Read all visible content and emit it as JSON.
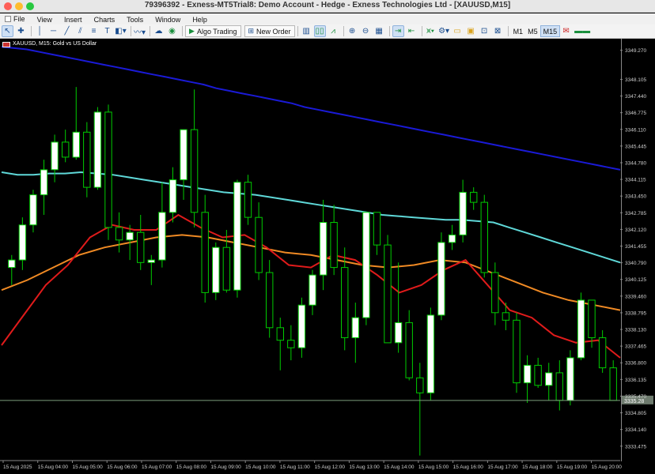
{
  "window": {
    "title": "79396392 - Exness-MT5Trial8: Demo Account - Hedge - Exness Technologies Ltd - [XAUUSD,M15]"
  },
  "menu": {
    "items": [
      "File",
      "View",
      "Insert",
      "Charts",
      "Tools",
      "Window",
      "Help"
    ]
  },
  "toolbar": {
    "algo_trading": "Algo Trading",
    "new_order": "New Order",
    "timeframes": [
      "M1",
      "M5",
      "M15"
    ],
    "active_timeframe": "M15",
    "icons": [
      "cursor-icon",
      "crosshair-icon",
      "vertical-line-icon",
      "horizontal-line-icon",
      "trendline-icon",
      "channel-icon",
      "fibonacci-icon",
      "text-icon",
      "shapes-icon",
      "indicator-icon",
      "cloud-icon",
      "signals-icon",
      "play-icon",
      "new-order-icon",
      "depth-icon",
      "bar-chart-icon",
      "candles-icon",
      "line-chart-icon",
      "zoom-in-icon",
      "zoom-out-icon",
      "grid-icon",
      "autoscroll-icon",
      "chart-shift-icon",
      "period-sep-icon",
      "templates-icon",
      "folder-icon",
      "save-icon",
      "alerts-icon",
      "history-icon"
    ]
  },
  "chart": {
    "symbol": "XAUUSD, M15:  Gold vs US Dollar",
    "current_price": "3335.28",
    "y_ticks": [
      "3349.270",
      "3348.105",
      "3347.440",
      "3346.775",
      "3346.110",
      "3345.445",
      "3344.780",
      "3344.115",
      "3343.450",
      "3342.785",
      "3342.120",
      "3341.455",
      "3340.790",
      "3340.125",
      "3339.460",
      "3338.795",
      "3338.130",
      "3337.465",
      "3336.800",
      "3336.135",
      "3335.470",
      "3334.805",
      "3334.140",
      "3333.475"
    ],
    "x_ticks": [
      "15 Aug 2025",
      "15 Aug 04:00",
      "15 Aug 05:00",
      "15 Aug 06:00",
      "15 Aug 07:00",
      "15 Aug 08:00",
      "15 Aug 09:00",
      "15 Aug 10:00",
      "15 Aug 11:00",
      "15 Aug 12:00",
      "15 Aug 13:00",
      "15 Aug 14:00",
      "15 Aug 15:00",
      "15 Aug 16:00",
      "15 Aug 17:00",
      "15 Aug 18:00",
      "15 Aug 19:00",
      "15 Aug 20:00"
    ],
    "colors": {
      "bull": "#ffffff",
      "bull_border": "#00cc00",
      "bear": "#000000",
      "wick": "#00cc00",
      "ma_blue": "#1a1ad6",
      "ma_cyan": "#5fd8d8",
      "ma_red": "#e01b1b",
      "ma_orange": "#f08a24",
      "price_line": "#7d9e7d"
    }
  },
  "chart_data": {
    "type": "candlestick",
    "ylim": [
      3332.9,
      3349.6
    ],
    "candles": [
      [
        3340.6,
        3341.1,
        3339.9,
        3340.9
      ],
      [
        3340.9,
        3342.6,
        3340.5,
        3342.3
      ],
      [
        3342.3,
        3343.7,
        3342.0,
        3343.5
      ],
      [
        3343.5,
        3344.9,
        3342.7,
        3344.5
      ],
      [
        3344.5,
        3345.9,
        3344.0,
        3345.6
      ],
      [
        3345.6,
        3346.1,
        3344.8,
        3345.0
      ],
      [
        3345.0,
        3347.8,
        3344.9,
        3346.0
      ],
      [
        3346.0,
        3346.4,
        3343.4,
        3343.8
      ],
      [
        3343.8,
        3347.0,
        3343.7,
        3346.8
      ],
      [
        3346.8,
        3347.1,
        3341.7,
        3342.2
      ],
      [
        3342.2,
        3342.8,
        3341.2,
        3341.7
      ],
      [
        3341.7,
        3342.3,
        3340.9,
        3342.0
      ],
      [
        3342.0,
        3342.7,
        3340.5,
        3340.8
      ],
      [
        3340.8,
        3341.1,
        3339.9,
        3340.9
      ],
      [
        3340.9,
        3344.0,
        3340.6,
        3342.8
      ],
      [
        3342.8,
        3344.6,
        3342.4,
        3344.1
      ],
      [
        3344.1,
        3346.1,
        3343.3,
        3346.1
      ],
      [
        3346.1,
        3347.7,
        3342.2,
        3342.8
      ],
      [
        3342.8,
        3343.5,
        3339.2,
        3339.6
      ],
      [
        3339.6,
        3341.6,
        3339.3,
        3341.4
      ],
      [
        3341.4,
        3342.1,
        3339.6,
        3339.7
      ],
      [
        3339.7,
        3344.1,
        3339.4,
        3344.0
      ],
      [
        3344.0,
        3344.3,
        3342.3,
        3342.6
      ],
      [
        3342.6,
        3343.2,
        3340.1,
        3340.4
      ],
      [
        3340.4,
        3340.9,
        3337.8,
        3338.2
      ],
      [
        3338.2,
        3338.6,
        3336.5,
        3337.7
      ],
      [
        3337.7,
        3338.3,
        3336.9,
        3337.4
      ],
      [
        3337.4,
        3339.4,
        3337.0,
        3339.1
      ],
      [
        3339.1,
        3340.5,
        3338.7,
        3340.3
      ],
      [
        3340.3,
        3343.3,
        3339.7,
        3342.4
      ],
      [
        3342.4,
        3343.1,
        3340.3,
        3340.6
      ],
      [
        3340.6,
        3341.4,
        3337.3,
        3337.8
      ],
      [
        3337.8,
        3339.2,
        3336.8,
        3338.6
      ],
      [
        3338.6,
        3342.1,
        3338.3,
        3342.8
      ],
      [
        3342.8,
        3342.6,
        3341.1,
        3341.5
      ],
      [
        3341.5,
        3341.9,
        3337.6,
        3337.6
      ],
      [
        3337.6,
        3340.8,
        3337.2,
        3338.4
      ],
      [
        3338.4,
        3338.9,
        3336.1,
        3336.2
      ],
      [
        3336.2,
        3336.8,
        3333.1,
        3335.6
      ],
      [
        3335.6,
        3339.0,
        3335.3,
        3338.7
      ],
      [
        3338.7,
        3342.0,
        3338.5,
        3341.6
      ],
      [
        3341.6,
        3342.3,
        3341.3,
        3341.9
      ],
      [
        3341.9,
        3344.1,
        3341.6,
        3343.6
      ],
      [
        3343.6,
        3343.8,
        3342.9,
        3343.2
      ],
      [
        3343.2,
        3343.5,
        3340.2,
        3340.4
      ],
      [
        3340.4,
        3340.8,
        3338.3,
        3338.8
      ],
      [
        3338.8,
        3339.2,
        3338.1,
        3338.5
      ],
      [
        3338.5,
        3338.8,
        3335.6,
        3336.0
      ],
      [
        3336.0,
        3337.1,
        3335.2,
        3336.7
      ],
      [
        3336.7,
        3337.0,
        3335.8,
        3335.9
      ],
      [
        3335.9,
        3336.8,
        3335.3,
        3336.4
      ],
      [
        3336.4,
        3336.9,
        3334.9,
        3335.3
      ],
      [
        3335.3,
        3337.3,
        3335.1,
        3337.0
      ],
      [
        3337.0,
        3339.6,
        3336.9,
        3339.3
      ],
      [
        3339.3,
        3339.3,
        3337.4,
        3337.8
      ],
      [
        3337.8,
        3338.1,
        3336.4,
        3336.6
      ],
      [
        3336.6,
        3336.9,
        3335.3,
        3335.3
      ]
    ],
    "ma_blue": [
      3349.4,
      3349.35,
      3349.3,
      3349.2,
      3349.1,
      3349.0,
      3348.9,
      3348.8,
      3348.7,
      3348.6,
      3348.5,
      3348.4,
      3348.3,
      3348.2,
      3348.1,
      3348.0,
      3347.9,
      3347.75,
      3347.65,
      3347.55,
      3347.45,
      3347.35,
      3347.25,
      3347.15,
      3347.0,
      3346.9,
      3346.8,
      3346.7,
      3346.6,
      3346.5,
      3346.4,
      3346.3,
      3346.2,
      3346.1,
      3346.0,
      3345.9,
      3345.8,
      3345.7,
      3345.6,
      3345.5,
      3345.4,
      3345.3,
      3345.2,
      3345.1,
      3345.0,
      3344.9,
      3344.8,
      3344.7,
      3344.6,
      3344.5
    ],
    "ma_cyan": [
      3344.4,
      3344.3,
      3344.3,
      3344.35,
      3344.35,
      3344.4,
      3344.35,
      3344.3,
      3344.2,
      3344.1,
      3344.0,
      3343.9,
      3343.8,
      3343.7,
      3343.6,
      3343.55,
      3343.5,
      3343.4,
      3343.3,
      3343.2,
      3343.1,
      3343.0,
      3342.9,
      3342.8,
      3342.7,
      3342.65,
      3342.6,
      3342.55,
      3342.5,
      3342.5,
      3342.45,
      3342.4,
      3342.2,
      3342.0,
      3341.8,
      3341.6,
      3341.4,
      3341.2,
      3341.0,
      3340.8
    ],
    "ma_red": [
      3337.5,
      3338.7,
      3339.9,
      3340.7,
      3341.8,
      3342.3,
      3342.1,
      3342.1,
      3342.7,
      3342.2,
      3341.8,
      3341.9,
      3341.4,
      3340.7,
      3340.6,
      3341.1,
      3340.9,
      3340.3,
      3339.6,
      3339.9,
      3340.5,
      3340.9,
      3339.9,
      3338.9,
      3338.6,
      3337.9,
      3337.6,
      3337.7,
      3337.0
    ],
    "ma_orange": [
      3339.7,
      3340.1,
      3340.6,
      3341.1,
      3341.4,
      3341.6,
      3341.8,
      3341.9,
      3341.8,
      3341.6,
      3341.4,
      3341.2,
      3341.1,
      3340.9,
      3340.7,
      3340.6,
      3340.7,
      3340.9,
      3340.8,
      3340.4,
      3340.0,
      3339.6,
      3339.3,
      3339.1,
      3338.9
    ]
  }
}
